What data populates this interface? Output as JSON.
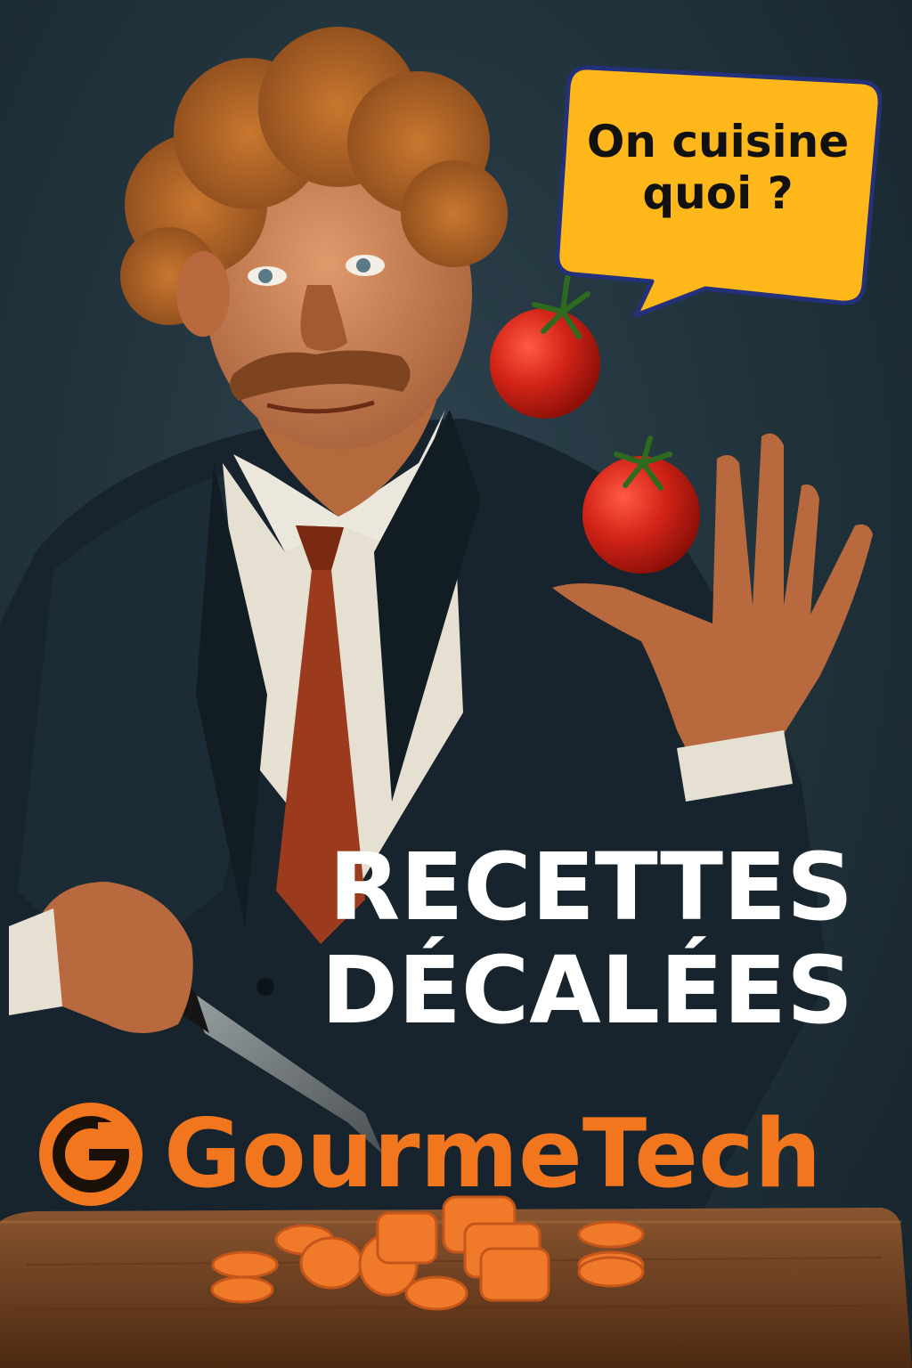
{
  "speech_bubble": {
    "text": "On cuisine\nquoi ?"
  },
  "headline": {
    "line1": "RECETTES",
    "line2": "DÉCALÉES"
  },
  "brand": {
    "logo_letter": "G",
    "name": "GourmeTech"
  },
  "colors": {
    "background": "#1d2b33",
    "bubble_fill": "#ffb71a",
    "bubble_border": "#23307a",
    "brand_orange": "#f2761e",
    "headline_text": "#ffffff",
    "tomato": "#c91d13",
    "carrot": "#f07a2a",
    "board": "#6b3d1f",
    "tie": "#9b3a1c"
  }
}
